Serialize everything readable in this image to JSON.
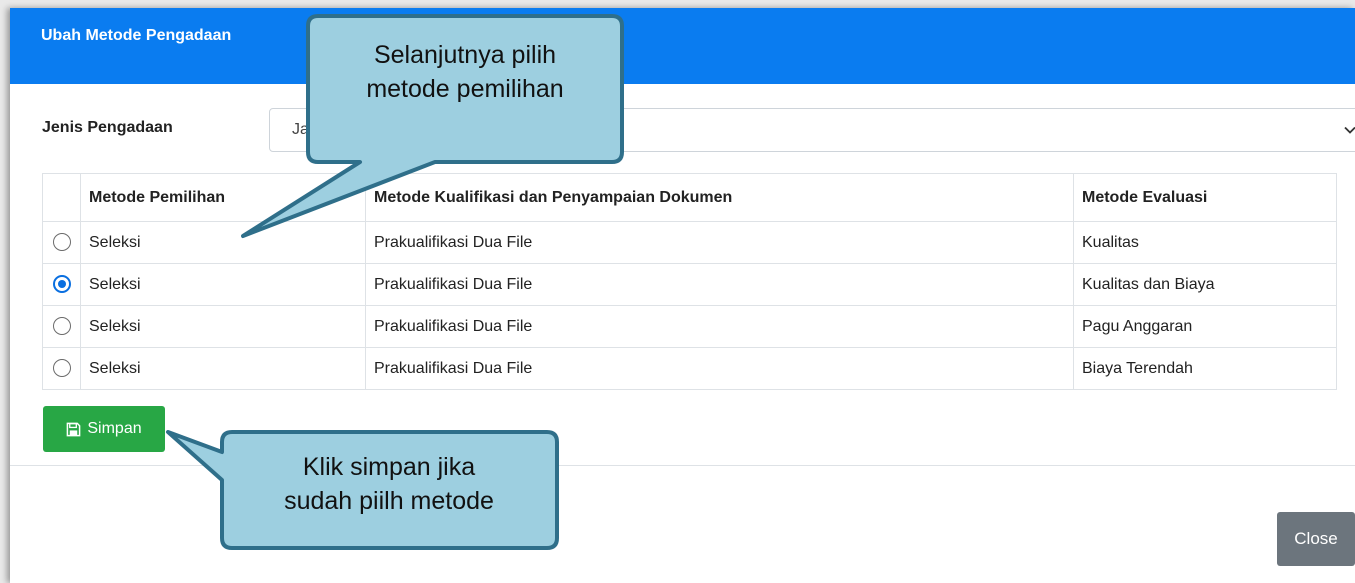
{
  "modal": {
    "title": "Ubah Metode Pengadaan",
    "jenis_label": "Jenis Pengadaan",
    "jenis_value": "Jasa Konsultansi Badan Usaha Konstruksi",
    "save_label": "Simpan",
    "close_label": "Close"
  },
  "table": {
    "headers": [
      "Metode Pemilihan",
      "Metode Kualifikasi dan Penyampaian Dokumen",
      "Metode Evaluasi"
    ],
    "rows": [
      {
        "metode": "Seleksi",
        "kualifikasi": "Prakualifikasi Dua File",
        "evaluasi": "Kualitas",
        "selected": false
      },
      {
        "metode": "Seleksi",
        "kualifikasi": "Prakualifikasi Dua File",
        "evaluasi": "Kualitas dan Biaya",
        "selected": true
      },
      {
        "metode": "Seleksi",
        "kualifikasi": "Prakualifikasi Dua File",
        "evaluasi": "Pagu Anggaran",
        "selected": false
      },
      {
        "metode": "Seleksi",
        "kualifikasi": "Prakualifikasi Dua File",
        "evaluasi": "Biaya Terendah",
        "selected": false
      }
    ]
  },
  "callouts": {
    "first_line1": "Selanjutnya pilih",
    "first_line2": "metode pemilihan",
    "second_line1": "Klik simpan jika",
    "second_line2": "sudah piilh metode"
  },
  "colors": {
    "header_blue": "#0a7cf0",
    "save_green": "#28a745",
    "close_gray": "#6c757d",
    "callout_fill": "#9dcfe0",
    "callout_border": "#2f6f8a"
  },
  "icons": {
    "save": "floppy-disk-icon",
    "dropdown": "chevron-down-icon"
  }
}
